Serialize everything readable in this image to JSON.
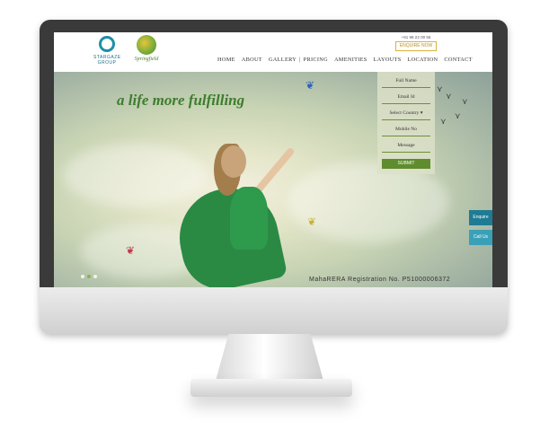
{
  "header": {
    "logo_left_text": "STARGAZE GROUP",
    "logo_right_text": "Springfield",
    "phone": "+91 98 22 00 55",
    "enquire_label": "ENQUIRE NOW"
  },
  "nav": {
    "items": [
      "HOME",
      "ABOUT",
      "GALLERY",
      "PRICING",
      "AMENITIES",
      "LAYOUTS",
      "LOCATION",
      "CONTACT"
    ],
    "separator": "|"
  },
  "hero": {
    "tagline": "a life more fulfilling",
    "rera": "MahaRERA Registration No. P51000006372"
  },
  "form": {
    "fields": [
      "Full Name",
      "Email Id",
      "Select Country",
      "Mobile No",
      "Message"
    ],
    "submit_label": "SUBMIT"
  },
  "side_buttons": [
    "Enquire",
    "Call Us"
  ],
  "colors": {
    "brand_green": "#3e7d2f",
    "submit_green": "#5f8c2e",
    "side_teal": "#1e7c94",
    "enquire_gold": "#b8902a"
  }
}
